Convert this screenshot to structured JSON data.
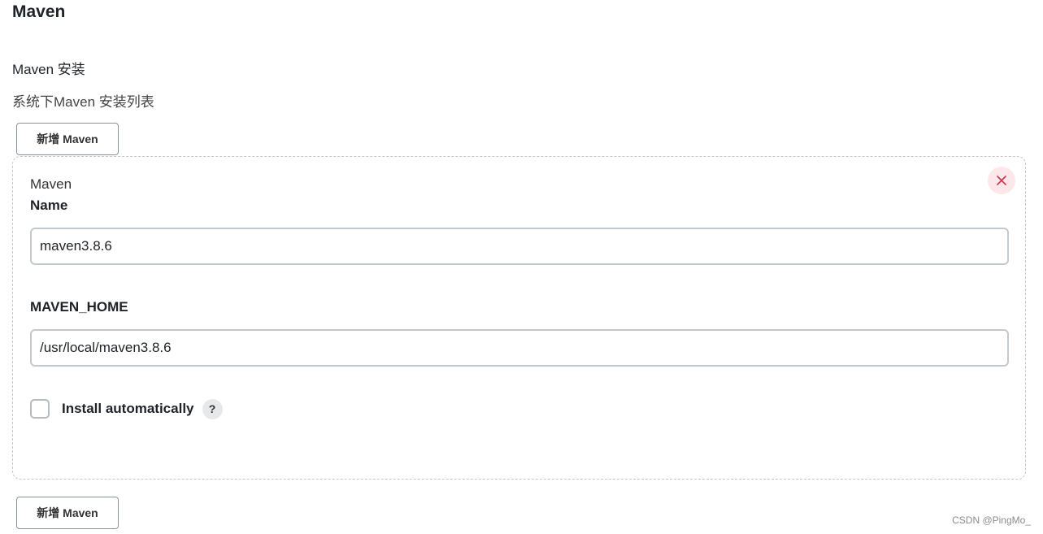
{
  "section": {
    "title": "Maven"
  },
  "installations": {
    "title": "Maven 安装",
    "description": "系统下Maven 安装列表",
    "add_button_label": "新增 Maven",
    "items": [
      {
        "kind": "Maven",
        "name_label": "Name",
        "name_value": "maven3.8.6",
        "home_label": "MAVEN_HOME",
        "home_value": "/usr/local/maven3.8.6",
        "install_auto_label": "Install automatically",
        "install_auto_checked": false,
        "help_icon": "?",
        "close_icon": "close-icon"
      }
    ]
  },
  "watermark": "CSDN @PingMo_",
  "colors": {
    "close_icon": "#d0334a",
    "close_bg": "#fde7ea"
  }
}
